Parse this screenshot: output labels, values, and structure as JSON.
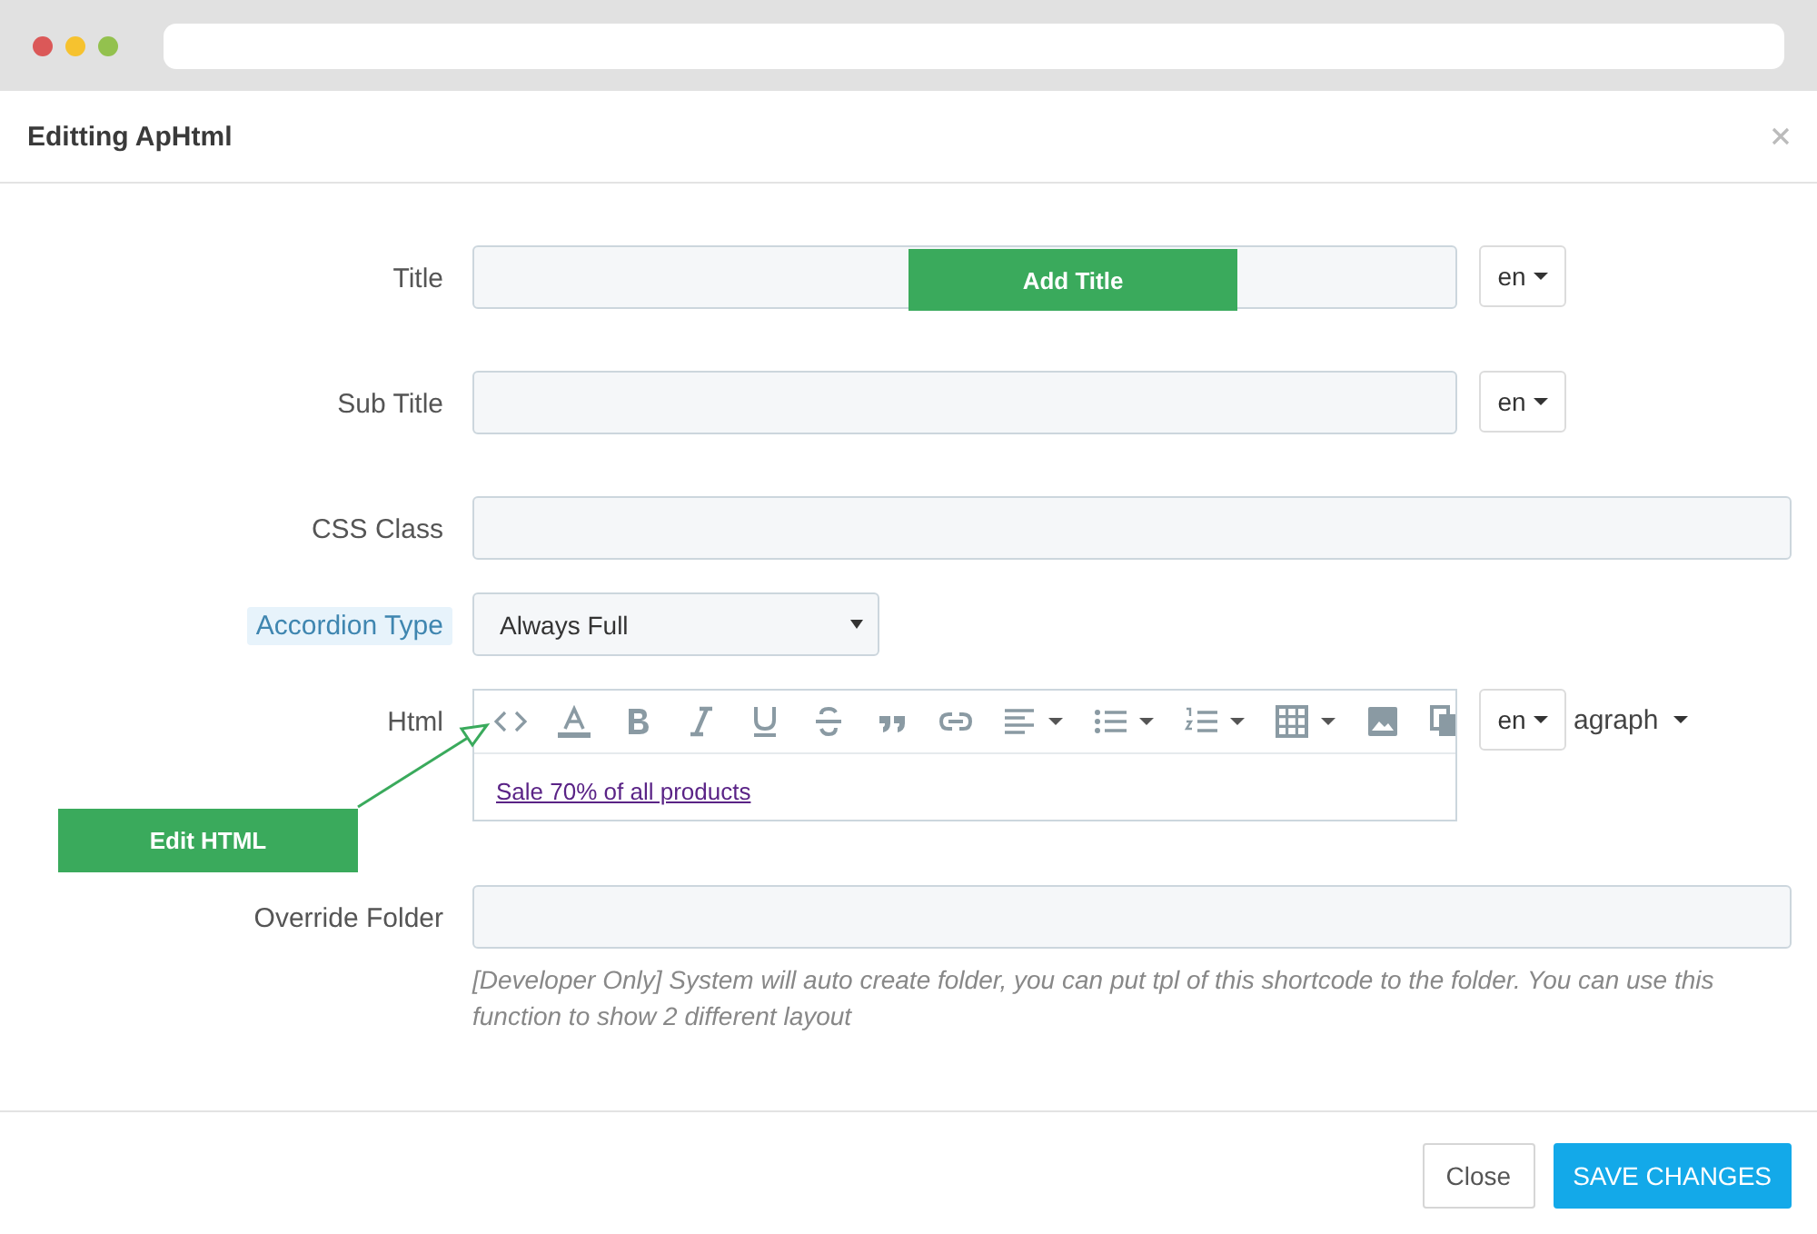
{
  "window": {
    "title": "Editting ApHtml"
  },
  "fields": [
    {
      "label": "Title",
      "kind": "text",
      "highlighted": false,
      "lang": "en"
    },
    {
      "label": "Sub Title",
      "kind": "text",
      "highlighted": false,
      "lang": "en"
    },
    {
      "label": "CSS Class",
      "kind": "text",
      "highlighted": false
    },
    {
      "label": "Accordion Type",
      "kind": "select",
      "highlighted": true,
      "value": "Always Full"
    },
    {
      "label": "Html",
      "kind": "editor",
      "highlighted": false,
      "lang": "en",
      "content": "Sale 70% of all products",
      "format_label": "agraph"
    },
    {
      "label": "Override Folder",
      "kind": "text",
      "highlighted": false,
      "help": "[Developer Only] System will auto create folder, you can put tpl of this shortcode to the folder. You can use this function to show 2 different layout"
    }
  ],
  "callouts": [
    {
      "text": "Add Title"
    },
    {
      "text": "Edit HTML"
    }
  ],
  "buttons": [
    {
      "label": "Close",
      "kind": "default"
    },
    {
      "label": "SAVE CHANGES",
      "kind": "primary"
    }
  ]
}
